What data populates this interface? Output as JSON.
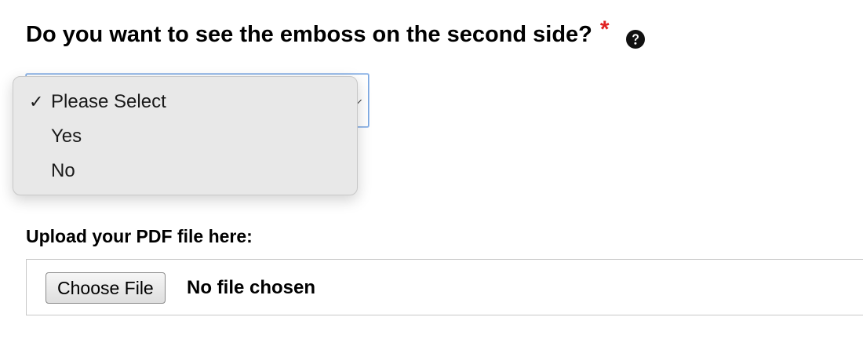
{
  "question": {
    "text": "Do you want to see the emboss on the second side?",
    "required_mark": "*"
  },
  "select": {
    "selected": "Please Select",
    "options": [
      {
        "label": "Please Select",
        "checked": true
      },
      {
        "label": "Yes",
        "checked": false
      },
      {
        "label": "No",
        "checked": false
      }
    ],
    "check_glyph": "✓"
  },
  "upload": {
    "label": "Upload your PDF file here:",
    "button_label": "Choose File",
    "status": "No file chosen"
  },
  "colors": {
    "required": "#e02020",
    "focus_border": "#7aa7e0",
    "dropdown_bg": "#e8e8e8"
  },
  "icons": {
    "help": "question-circle-icon",
    "check": "checkmark-icon",
    "arrow": "chevron-down-icon"
  }
}
